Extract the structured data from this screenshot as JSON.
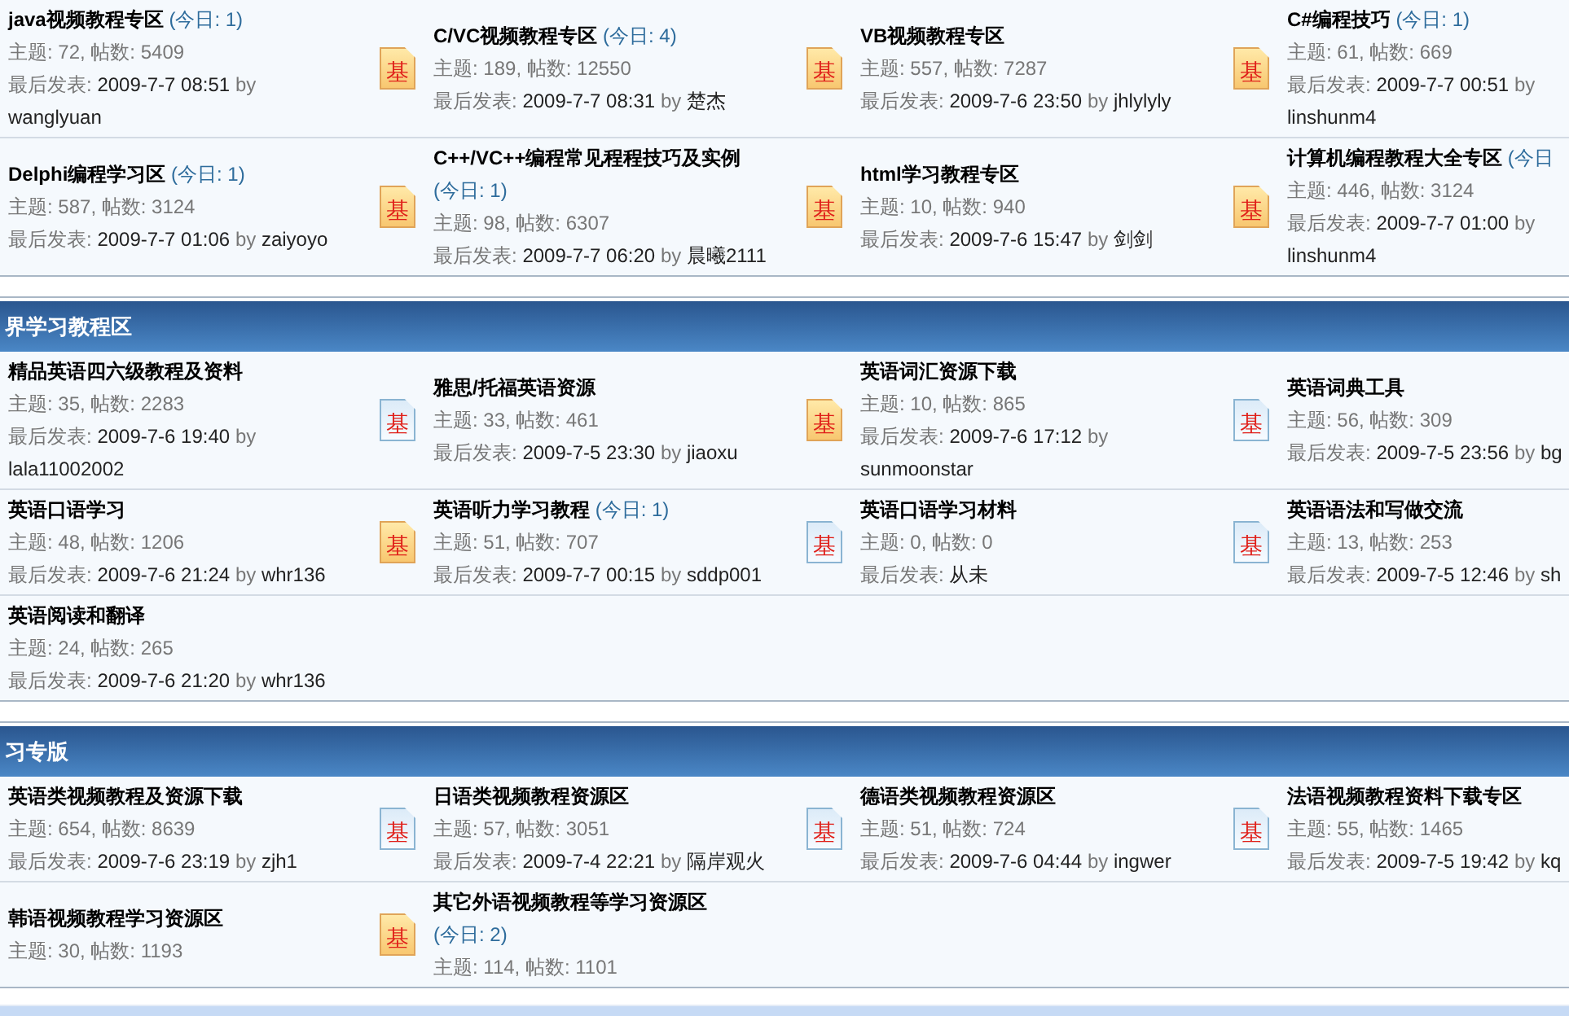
{
  "sections": [
    {
      "rows": [
        {
          "forums": [
            {
              "name": "java视频教程专区",
              "today": "(今日: 1)",
              "stats": "主题: 72, 帖数: 5409",
              "last_post": {
                "label": "最后发表:",
                "date": "2009-7-7 08:51",
                "by": "by",
                "author": "wanglyuan"
              }
            },
            {
              "name": "C/VC视频教程专区",
              "today": "(今日: 4)",
              "icon": {
                "unread": true,
                "text": "基"
              },
              "stats": "主题: 189, 帖数: 12550",
              "last_post": {
                "label": "最后发表:",
                "date": "2009-7-7 08:31",
                "by": "by",
                "author": "楚杰"
              }
            },
            {
              "name": "VB视频教程专区",
              "icon": {
                "unread": true,
                "text": "基"
              },
              "stats": "主题: 557, 帖数: 7287",
              "last_post": {
                "label": "最后发表:",
                "date": "2009-7-6 23:50",
                "by": "by",
                "author": "jhlylyly"
              }
            },
            {
              "name": "C#编程技巧",
              "today": "(今日: 1)",
              "icon": {
                "unread": true,
                "text": "基"
              },
              "stats": "主题: 61, 帖数: 669",
              "last_post": {
                "label": "最后发表:",
                "date": "2009-7-7 00:51",
                "by": "by",
                "author": "linshunm4"
              }
            }
          ]
        },
        {
          "forums": [
            {
              "name": "Delphi编程学习区",
              "today": "(今日: 1)",
              "stats": "主题: 587, 帖数: 3124",
              "last_post": {
                "label": "最后发表:",
                "date": "2009-7-7 01:06",
                "by": "by",
                "author": "zaiyoyo"
              }
            },
            {
              "name": "C++/VC++编程常见程程技巧及实例",
              "today": "(今日: 1)",
              "icon": {
                "unread": true,
                "text": "基"
              },
              "stats": "主题: 98, 帖数: 6307",
              "last_post": {
                "label": "最后发表:",
                "date": "2009-7-7 06:20",
                "by": "by",
                "author": "晨曦2111"
              }
            },
            {
              "name": "html学习教程专区",
              "icon": {
                "unread": true,
                "text": "基"
              },
              "stats": "主题: 10, 帖数: 940",
              "last_post": {
                "label": "最后发表:",
                "date": "2009-7-6 15:47",
                "by": "by",
                "author": "剑剑"
              }
            },
            {
              "name": "计算机编程教程大全专区",
              "today": "(今日",
              "icon": {
                "unread": true,
                "text": "基"
              },
              "stats": "主题: 446, 帖数: 3124",
              "last_post": {
                "label": "最后发表:",
                "date": "2009-7-7 01:00",
                "by": "by",
                "author": "linshunm4"
              }
            }
          ]
        }
      ]
    },
    {
      "title": "界学习教程区",
      "rows": [
        {
          "forums": [
            {
              "name": "精品英语四六级教程及资料",
              "stats": "主题: 35, 帖数: 2283",
              "last_post": {
                "label": "最后发表:",
                "date": "2009-7-6 19:40",
                "by": "by",
                "author": "lala11002002"
              }
            },
            {
              "name": "雅思/托福英语资源",
              "icon": {
                "unread": false,
                "text": "基"
              },
              "stats": "主题: 33, 帖数: 461",
              "last_post": {
                "label": "最后发表:",
                "date": "2009-7-5 23:30",
                "by": "by",
                "author": "jiaoxu"
              }
            },
            {
              "name": "英语词汇资源下载",
              "icon": {
                "unread": true,
                "text": "基"
              },
              "stats": "主题: 10, 帖数: 865",
              "last_post": {
                "label": "最后发表:",
                "date": "2009-7-6 17:12",
                "by": "by",
                "author": "sunmoonstar"
              }
            },
            {
              "name": "英语词典工具",
              "icon": {
                "unread": false,
                "text": "基"
              },
              "stats": "主题: 56, 帖数: 309",
              "last_post": {
                "label": "最后发表:",
                "date": "2009-7-5 23:56",
                "by": "by",
                "author": "bg"
              }
            }
          ]
        },
        {
          "forums": [
            {
              "name": "英语口语学习",
              "stats": "主题: 48, 帖数: 1206",
              "last_post": {
                "label": "最后发表:",
                "date": "2009-7-6 21:24",
                "by": "by",
                "author": "whr136"
              }
            },
            {
              "name": "英语听力学习教程",
              "today": "(今日: 1)",
              "icon": {
                "unread": true,
                "text": "基"
              },
              "stats": "主题: 51, 帖数: 707",
              "last_post": {
                "label": "最后发表:",
                "date": "2009-7-7 00:15",
                "by": "by",
                "author": "sddp001"
              }
            },
            {
              "name": "英语口语学习材料",
              "icon": {
                "unread": false,
                "text": "基"
              },
              "stats": "主题: 0, 帖数: 0",
              "last_post": {
                "label": "最后发表:",
                "date": "从未"
              }
            },
            {
              "name": "英语语法和写做交流",
              "icon": {
                "unread": false,
                "text": "基"
              },
              "stats": "主题: 13, 帖数: 253",
              "last_post": {
                "label": "最后发表:",
                "date": "2009-7-5 12:46",
                "by": "by",
                "author": "sh"
              }
            }
          ]
        },
        {
          "forums": [
            {
              "name": "英语阅读和翻译",
              "stats": "主题: 24, 帖数: 265",
              "last_post": {
                "label": "最后发表:",
                "date": "2009-7-6 21:20",
                "by": "by",
                "author": "whr136"
              }
            }
          ]
        }
      ]
    },
    {
      "title": "习专版",
      "rows": [
        {
          "forums": [
            {
              "name": "英语类视频教程及资源下载",
              "stats": "主题: 654, 帖数: 8639",
              "last_post": {
                "label": "最后发表:",
                "date": "2009-7-6 23:19",
                "by": "by",
                "author": "zjh1"
              }
            },
            {
              "name": "日语类视频教程资源区",
              "icon": {
                "unread": false,
                "text": "基"
              },
              "stats": "主题: 57, 帖数: 3051",
              "last_post": {
                "label": "最后发表:",
                "date": "2009-7-4 22:21",
                "by": "by",
                "author": "隔岸观火"
              }
            },
            {
              "name": "德语类视频教程资源区",
              "icon": {
                "unread": false,
                "text": "基"
              },
              "stats": "主题: 51, 帖数: 724",
              "last_post": {
                "label": "最后发表:",
                "date": "2009-7-6 04:44",
                "by": "by",
                "author": "ingwer"
              }
            },
            {
              "name": "法语视频教程资料下载专区",
              "icon": {
                "unread": false,
                "text": "基"
              },
              "stats": "主题: 55, 帖数: 1465",
              "last_post": {
                "label": "最后发表:",
                "date": "2009-7-5 19:42",
                "by": "by",
                "author": "kq"
              }
            }
          ]
        },
        {
          "forums": [
            {
              "name": "韩语视频教程学习资源区",
              "stats": "主题: 30, 帖数: 1193"
            },
            {
              "name": "其它外语视频教程等学习资源区",
              "today": "(今日: 2)",
              "icon": {
                "unread": true,
                "text": "基"
              },
              "stats": "主题: 114, 帖数: 1101"
            }
          ]
        }
      ]
    }
  ]
}
